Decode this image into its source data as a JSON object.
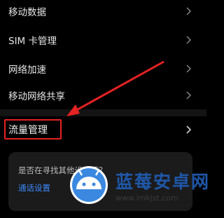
{
  "settings": {
    "items": [
      {
        "label": "移动数据"
      },
      {
        "label": "SIM 卡管理"
      },
      {
        "label": "网络加速"
      },
      {
        "label": "移动网络共享"
      },
      {
        "label": "流量管理"
      }
    ]
  },
  "suggestion_card": {
    "question": "是否在寻找其他设置项？",
    "link": "通话设置"
  },
  "watermark": {
    "name": "蓝莓安卓网",
    "url": "www.lmkjst.com"
  },
  "colors": {
    "background": "#000000",
    "annotation_red": "#e52222",
    "link_blue": "#3d8bff",
    "watermark_blue": "#1f57a8"
  },
  "icons": [
    "chevron-right-icon",
    "arrow-annotation-icon",
    "android-robot-icon"
  ]
}
